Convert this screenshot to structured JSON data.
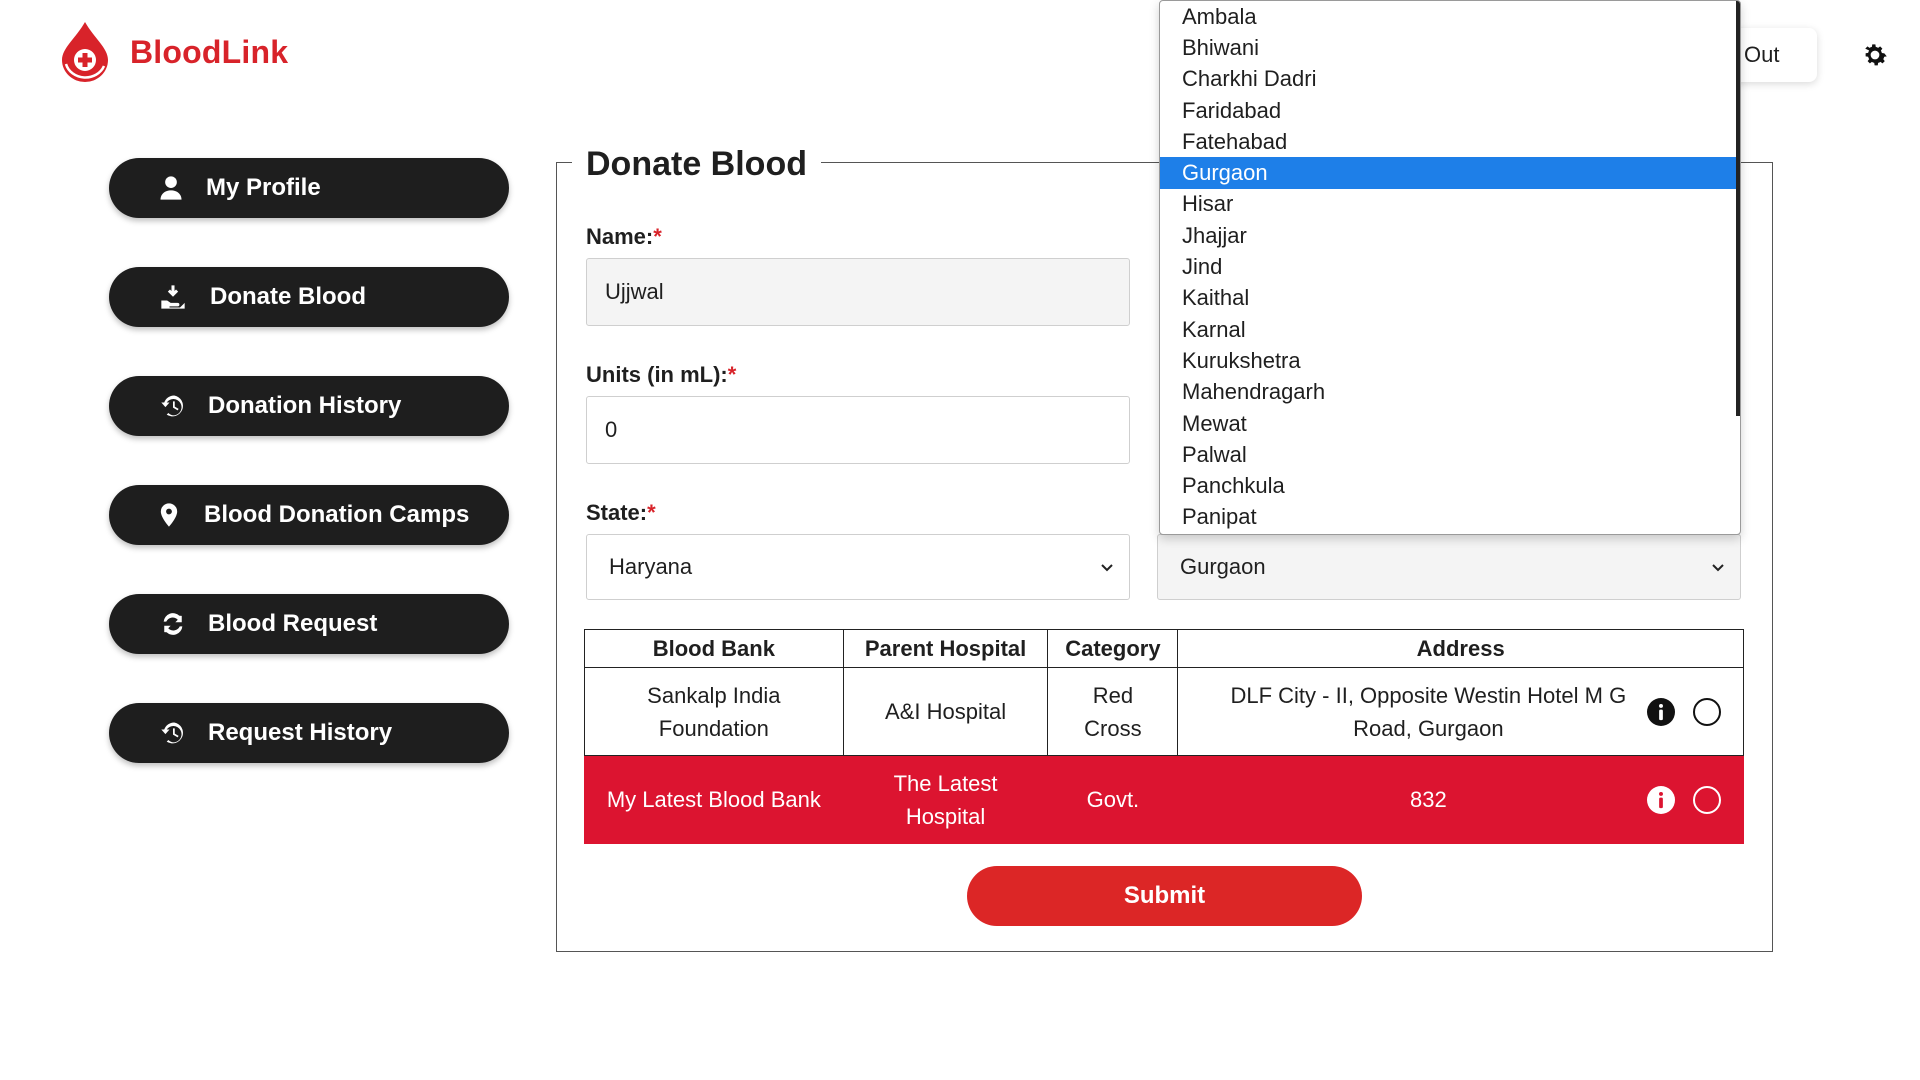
{
  "app": {
    "name": "BloodLink"
  },
  "header": {
    "logout_label": "Out"
  },
  "sidebar": {
    "items": [
      {
        "label": "My Profile",
        "icon": "user-icon"
      },
      {
        "label": "Donate Blood",
        "icon": "hand-donate-icon"
      },
      {
        "label": "Donation History",
        "icon": "history-icon"
      },
      {
        "label": "Blood Donation Camps",
        "icon": "location-pin-icon"
      },
      {
        "label": "Blood Request",
        "icon": "refresh-icon"
      },
      {
        "label": "Request History",
        "icon": "history-icon"
      }
    ]
  },
  "form": {
    "title": "Donate Blood",
    "name_label": "Name:",
    "name_value": "Ujjwal",
    "units_label": "Units (in mL):",
    "units_value": "0",
    "state_label": "State:",
    "required_mark": "*",
    "state_value": "Haryana",
    "district_value": "Gurgaon",
    "submit_label": "Submit"
  },
  "table": {
    "headers": [
      "Blood Bank",
      "Parent Hospital",
      "Category",
      "Address"
    ],
    "rows": [
      {
        "bank": "Sankalp India Foundation",
        "hospital": "A&I Hospital",
        "category": "Red Cross",
        "address": "DLF City - II, Opposite Westin Hotel M G Road, Gurgaon",
        "selected": false
      },
      {
        "bank": "My Latest Blood Bank",
        "hospital": "The Latest Hospital",
        "category": "Govt.",
        "address": "832",
        "selected": true
      }
    ]
  },
  "district_dropdown": {
    "options": [
      "Ambala",
      "Bhiwani",
      "Charkhi Dadri",
      "Faridabad",
      "Fatehabad",
      "Gurgaon",
      "Hisar",
      "Jhajjar",
      "Jind",
      "Kaithal",
      "Karnal",
      "Kurukshetra",
      "Mahendragarh",
      "Mewat",
      "Palwal",
      "Panchkula",
      "Panipat"
    ],
    "highlighted": "Gurgaon"
  },
  "colors": {
    "brand_red": "#d8232a",
    "selected_row": "#dc1430",
    "dropdown_highlight": "#1e7fe8",
    "sidebar_button": "#1e1e1e"
  }
}
